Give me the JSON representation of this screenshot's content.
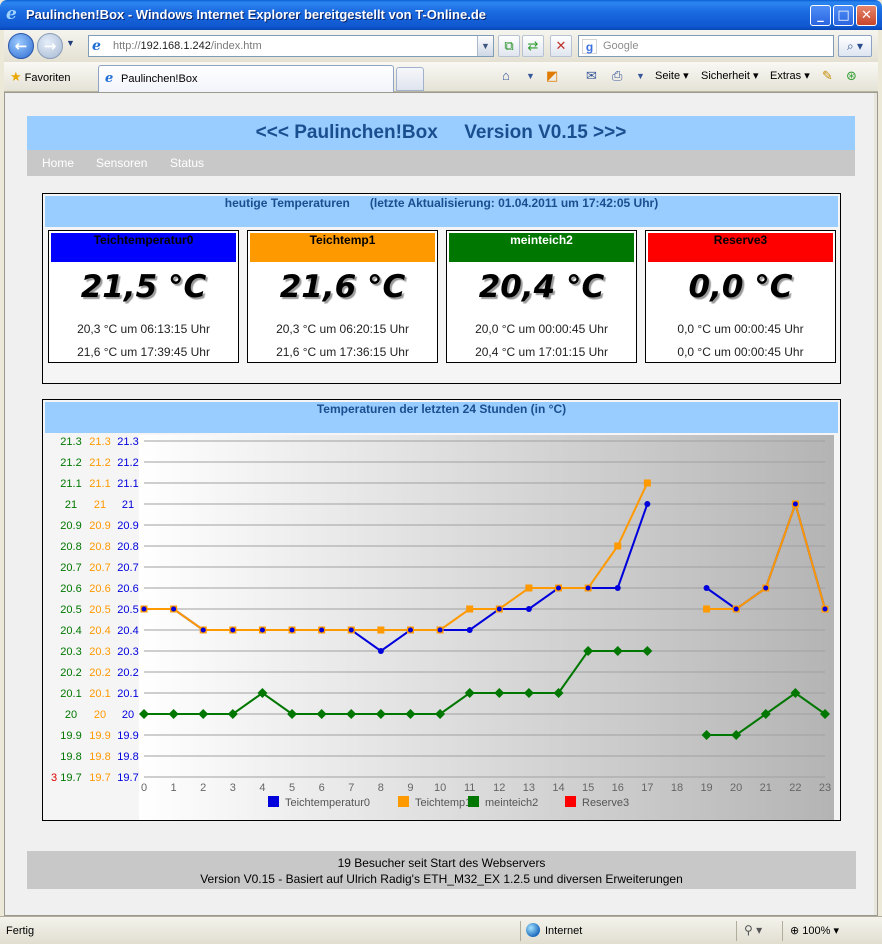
{
  "window": {
    "title": "Paulinchen!Box - Windows Internet Explorer bereitgestellt von T-Online.de",
    "minimize_glyph": "_",
    "maximize_glyph": "□",
    "close_glyph": "✕"
  },
  "navbar": {
    "url_prefix": "http://",
    "url_host": "192.168.1.242",
    "url_path": "/index.htm",
    "search_placeholder": "Google"
  },
  "favbar": {
    "favorites_label": "Favoriten",
    "tab_label": "Paulinchen!Box",
    "commands": {
      "page": "Seite",
      "security": "Sicherheit",
      "extras": "Extras"
    }
  },
  "page": {
    "header_title": "<<< Paulinchen!Box     Version V0.15 >>>",
    "menu": [
      "Home",
      "Sensoren",
      "Status"
    ],
    "temps_title": "heutige Temperaturen      (letzte Aktualisierung: 01.04.2011 um 17:42:05 Uhr)",
    "sensors": [
      {
        "name": "Teichtemperatur0",
        "color": "#0000ff",
        "text_color": "#000000",
        "value": "21,5 °C",
        "min_line": "20,3 °C um 06:13:15 Uhr",
        "max_line": "21,6 °C um 17:39:45 Uhr"
      },
      {
        "name": "Teichtemp1",
        "color": "#ff9900",
        "text_color": "#000000",
        "value": "21,6 °C",
        "min_line": "20,3 °C um 06:20:15 Uhr",
        "max_line": "21,6 °C um 17:36:15 Uhr"
      },
      {
        "name": "meinteich2",
        "color": "#007700",
        "text_color": "#ffffff",
        "value": "20,4 °C",
        "min_line": "20,0 °C um 00:00:45 Uhr",
        "max_line": "20,4 °C um 17:01:15 Uhr"
      },
      {
        "name": "Reserve3",
        "color": "#ff0000",
        "text_color": "#000000",
        "value": "0,0 °C",
        "min_line": "0,0 °C um 00:00:45 Uhr",
        "max_line": "0,0 °C um 00:00:45 Uhr"
      }
    ],
    "chart_title": "Temperaturen der letzten 24 Stunden (in °C)",
    "footer_line1": "19 Besucher seit Start des Webservers",
    "footer_line2": "Version V0.15 - Basiert auf Ulrich Radig's ETH_M32_EX 1.2.5 und diversen Erweiterungen"
  },
  "statusbar": {
    "left": "Fertig",
    "zone": "Internet",
    "zoom": "100%"
  },
  "chart_data": {
    "type": "line",
    "title": "Temperaturen der letzten 24 Stunden (in °C)",
    "x": [
      0,
      1,
      2,
      3,
      4,
      5,
      6,
      7,
      8,
      9,
      10,
      11,
      12,
      13,
      14,
      15,
      16,
      17,
      18,
      19,
      20,
      21,
      22,
      23
    ],
    "xlim": [
      0,
      23
    ],
    "ylim": [
      19.7,
      21.3
    ],
    "y_ticks": [
      "19.7",
      "19.8",
      "19.9",
      "20",
      "20.1",
      "20.2",
      "20.3",
      "20.4",
      "20.5",
      "20.6",
      "20.7",
      "20.8",
      "20.9",
      "21",
      "21.1",
      "21.2",
      "21.3"
    ],
    "extra_axis_label": "3",
    "grid": true,
    "legend_position": "bottom",
    "series": [
      {
        "name": "Teichtemperatur0",
        "color": "#0000dd",
        "marker": "circle",
        "values": [
          20.5,
          20.5,
          20.4,
          20.4,
          20.4,
          20.4,
          20.4,
          20.4,
          20.3,
          20.4,
          20.4,
          20.4,
          20.5,
          20.5,
          20.6,
          20.6,
          20.6,
          21.0,
          null,
          20.6,
          20.5,
          20.6,
          21.0,
          20.5
        ]
      },
      {
        "name": "Teichtemp1",
        "color": "#ff9900",
        "marker": "square",
        "values": [
          20.5,
          20.5,
          20.4,
          20.4,
          20.4,
          20.4,
          20.4,
          20.4,
          20.4,
          20.4,
          20.4,
          20.5,
          20.5,
          20.6,
          20.6,
          20.6,
          20.8,
          21.1,
          null,
          20.5,
          20.5,
          20.6,
          21.0,
          20.5
        ]
      },
      {
        "name": "meinteich2",
        "color": "#007700",
        "marker": "diamond",
        "values": [
          20.0,
          20.0,
          20.0,
          20.0,
          20.1,
          20.0,
          20.0,
          20.0,
          20.0,
          20.0,
          20.0,
          20.1,
          20.1,
          20.1,
          20.1,
          20.3,
          20.3,
          20.3,
          null,
          19.9,
          19.9,
          20.0,
          20.1,
          20.0
        ]
      },
      {
        "name": "Reserve3",
        "color": "#ff0000",
        "marker": "square",
        "values": []
      }
    ]
  }
}
